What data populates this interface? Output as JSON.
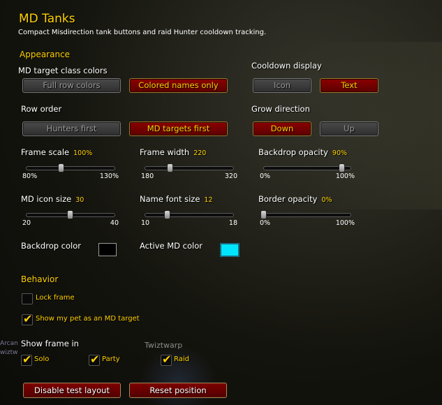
{
  "header": {
    "title": "MD Tanks",
    "subtitle": "Compact Misdirection tank buttons and raid Hunter cooldown tracking."
  },
  "appearance": {
    "heading": "Appearance",
    "class_colors": {
      "label": "MD target class colors",
      "full_row": "Full row colors",
      "colored_names": "Colored names only",
      "selected": "Colored names only"
    },
    "cooldown_display": {
      "label": "Cooldown display",
      "icon": "Icon",
      "text": "Text",
      "selected": "Text"
    },
    "row_order": {
      "label": "Row order",
      "hunters_first": "Hunters first",
      "md_targets_first": "MD targets first",
      "selected": "MD targets first"
    },
    "grow_direction": {
      "label": "Grow direction",
      "down": "Down",
      "up": "Up",
      "selected": "Down"
    },
    "frame_scale": {
      "label": "Frame scale",
      "value": "100%",
      "min": "80%",
      "max": "130%",
      "position": 0.4
    },
    "frame_width": {
      "label": "Frame width",
      "value": "220",
      "min": "180",
      "max": "320",
      "position": 0.2857
    },
    "backdrop_opacity": {
      "label": "Backdrop opacity",
      "value": "90%",
      "min": "0%",
      "max": "100%",
      "position": 0.9
    },
    "md_icon_size": {
      "label": "MD icon size",
      "value": "30",
      "min": "20",
      "max": "40",
      "position": 0.5
    },
    "name_font_size": {
      "label": "Name font size",
      "value": "12",
      "min": "10",
      "max": "18",
      "position": 0.25
    },
    "border_opacity": {
      "label": "Border opacity",
      "value": "0%",
      "min": "0%",
      "max": "100%",
      "position": 0.0
    },
    "backdrop_color": {
      "label": "Backdrop color",
      "color": "#000000"
    },
    "active_md_color": {
      "label": "Active MD color",
      "color": "#00e5ff"
    }
  },
  "behavior": {
    "heading": "Behavior",
    "lock_frame": {
      "label": "Lock frame",
      "checked": false
    },
    "show_pet": {
      "label": "Show my pet as an MD target",
      "checked": true
    }
  },
  "show_frame": {
    "heading": "Show frame in",
    "solo": {
      "label": "Solo",
      "checked": true
    },
    "party": {
      "label": "Party",
      "checked": true
    },
    "raid": {
      "label": "Raid",
      "checked": true
    }
  },
  "footer": {
    "disable_test_layout": "Disable test layout",
    "reset_position": "Reset position"
  },
  "background_overlay": {
    "name1": "Twiztwarp",
    "name2": "Arcan",
    "name3": "wiztw"
  },
  "colors": {
    "accent_gold": "#ffd100",
    "button_red": "#8b0000",
    "button_gray": "#3a3a3a"
  }
}
